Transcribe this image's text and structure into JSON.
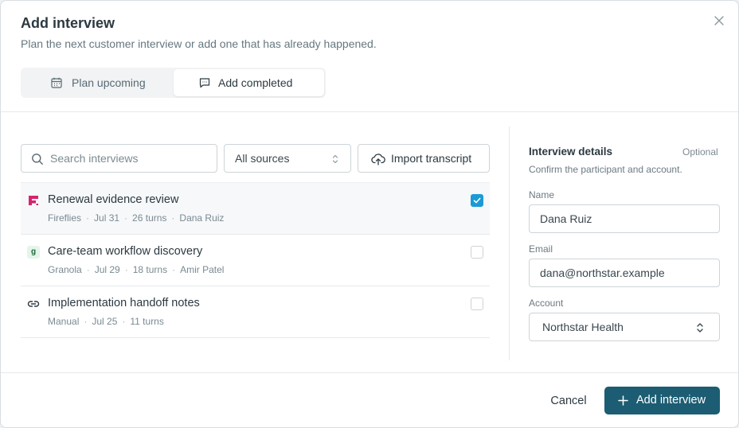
{
  "dialog": {
    "title": "Add interview",
    "subtitle": "Plan the next customer interview or add one that has already happened.",
    "close_icon": "close-icon"
  },
  "tabs": [
    {
      "label": "Plan upcoming",
      "icon": "calendar-icon",
      "active": false
    },
    {
      "label": "Add completed",
      "icon": "chat-icon",
      "active": true
    }
  ],
  "toolbar": {
    "search_placeholder": "Search interviews",
    "source_select": "All sources",
    "import_label": "Import transcript",
    "import_icon": "upload-cloud-icon"
  },
  "interviews": [
    {
      "name": "Renewal evidence review",
      "source": "Fireflies",
      "date": "Jul 31",
      "turns": "26 turns",
      "participant": "Dana Ruiz",
      "icon": "fireflies-icon",
      "checked": true
    },
    {
      "name": "Care-team workflow discovery",
      "source": "Granola",
      "date": "Jul 29",
      "turns": "18 turns",
      "participant": "Amir Patel",
      "icon": "granola-icon",
      "icon_letter": "g",
      "checked": false
    },
    {
      "name": "Implementation handoff notes",
      "source": "Manual",
      "date": "Jul 25",
      "turns": "11 turns",
      "participant": "",
      "icon": "link-icon",
      "checked": false
    }
  ],
  "details": {
    "title": "Interview details",
    "optional": "Optional",
    "subtitle": "Confirm the participant and account.",
    "name_label": "Name",
    "name_value": "Dana Ruiz",
    "email_label": "Email",
    "email_value": "dana@northstar.example",
    "account_label": "Account",
    "account_value": "Northstar Health"
  },
  "footer": {
    "cancel_label": "Cancel",
    "add_label": "Add interview"
  },
  "colors": {
    "primary": "#1c5d73",
    "checkbox_checked": "#1a9ad6",
    "fireflies_brand": "#d6246e"
  }
}
